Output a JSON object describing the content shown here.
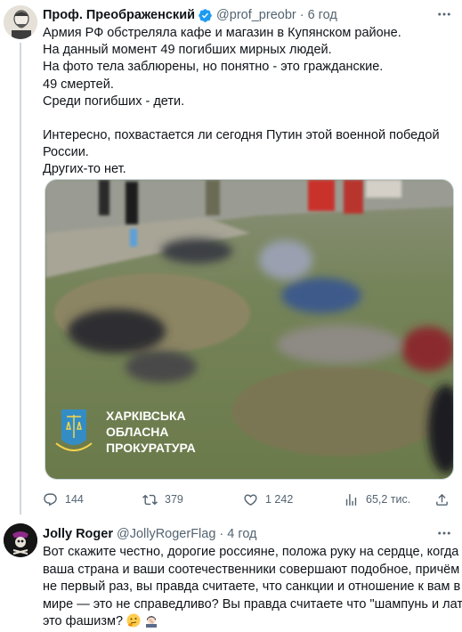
{
  "tweet1": {
    "author_name": "Проф. Преображенский",
    "handle": "@prof_preobr",
    "separator": "·",
    "time": "6 год",
    "lines": [
      "Армия РФ обстреляла кафе и магазин в Купянском районе.",
      "На данный момент 49 погибших мирных людей.",
      "На фото тела заблюрены, но понятно - это гражданские.",
      "49 смертей.",
      "Среди погибших - дети."
    ],
    "lines2": [
      "Интересно, похвастается ли сегодня Путин этой военной победой",
      "России.",
      "Других-то нет."
    ],
    "media": {
      "watermark_line1": "ХАРКІВСЬКА",
      "watermark_line2": "ОБЛАСНА",
      "watermark_line3": "ПРОКУРАТУРА"
    },
    "actions": {
      "replies": "144",
      "retweets": "379",
      "likes": "1 242",
      "views": "65,2 тис."
    }
  },
  "tweet2": {
    "author_name": "Jolly Roger",
    "handle": "@JollyRogerFlag",
    "separator": "·",
    "time": "4 год",
    "lines": [
      "Вот скажите честно, дорогие россияне, положа руку на сердце, когда",
      "ваша страна и ваши соотечественники совершают подобное, причём",
      "не первый раз, вы правда считаете, что санкции и отношение к вам в",
      "мире — это не справедливо? Вы правда считаете что \"шампунь и латте\""
    ],
    "last_line": "это фашизм?"
  },
  "colors": {
    "text": "#0f1419",
    "secondary": "#536471",
    "verified": "#1d9bf0",
    "border": "#cfd9de"
  },
  "icons": [
    "verified-icon",
    "more-icon",
    "reply-icon",
    "retweet-icon",
    "like-icon",
    "views-icon",
    "share-icon",
    "thinking-face-emoji",
    "facepalm-emoji"
  ]
}
